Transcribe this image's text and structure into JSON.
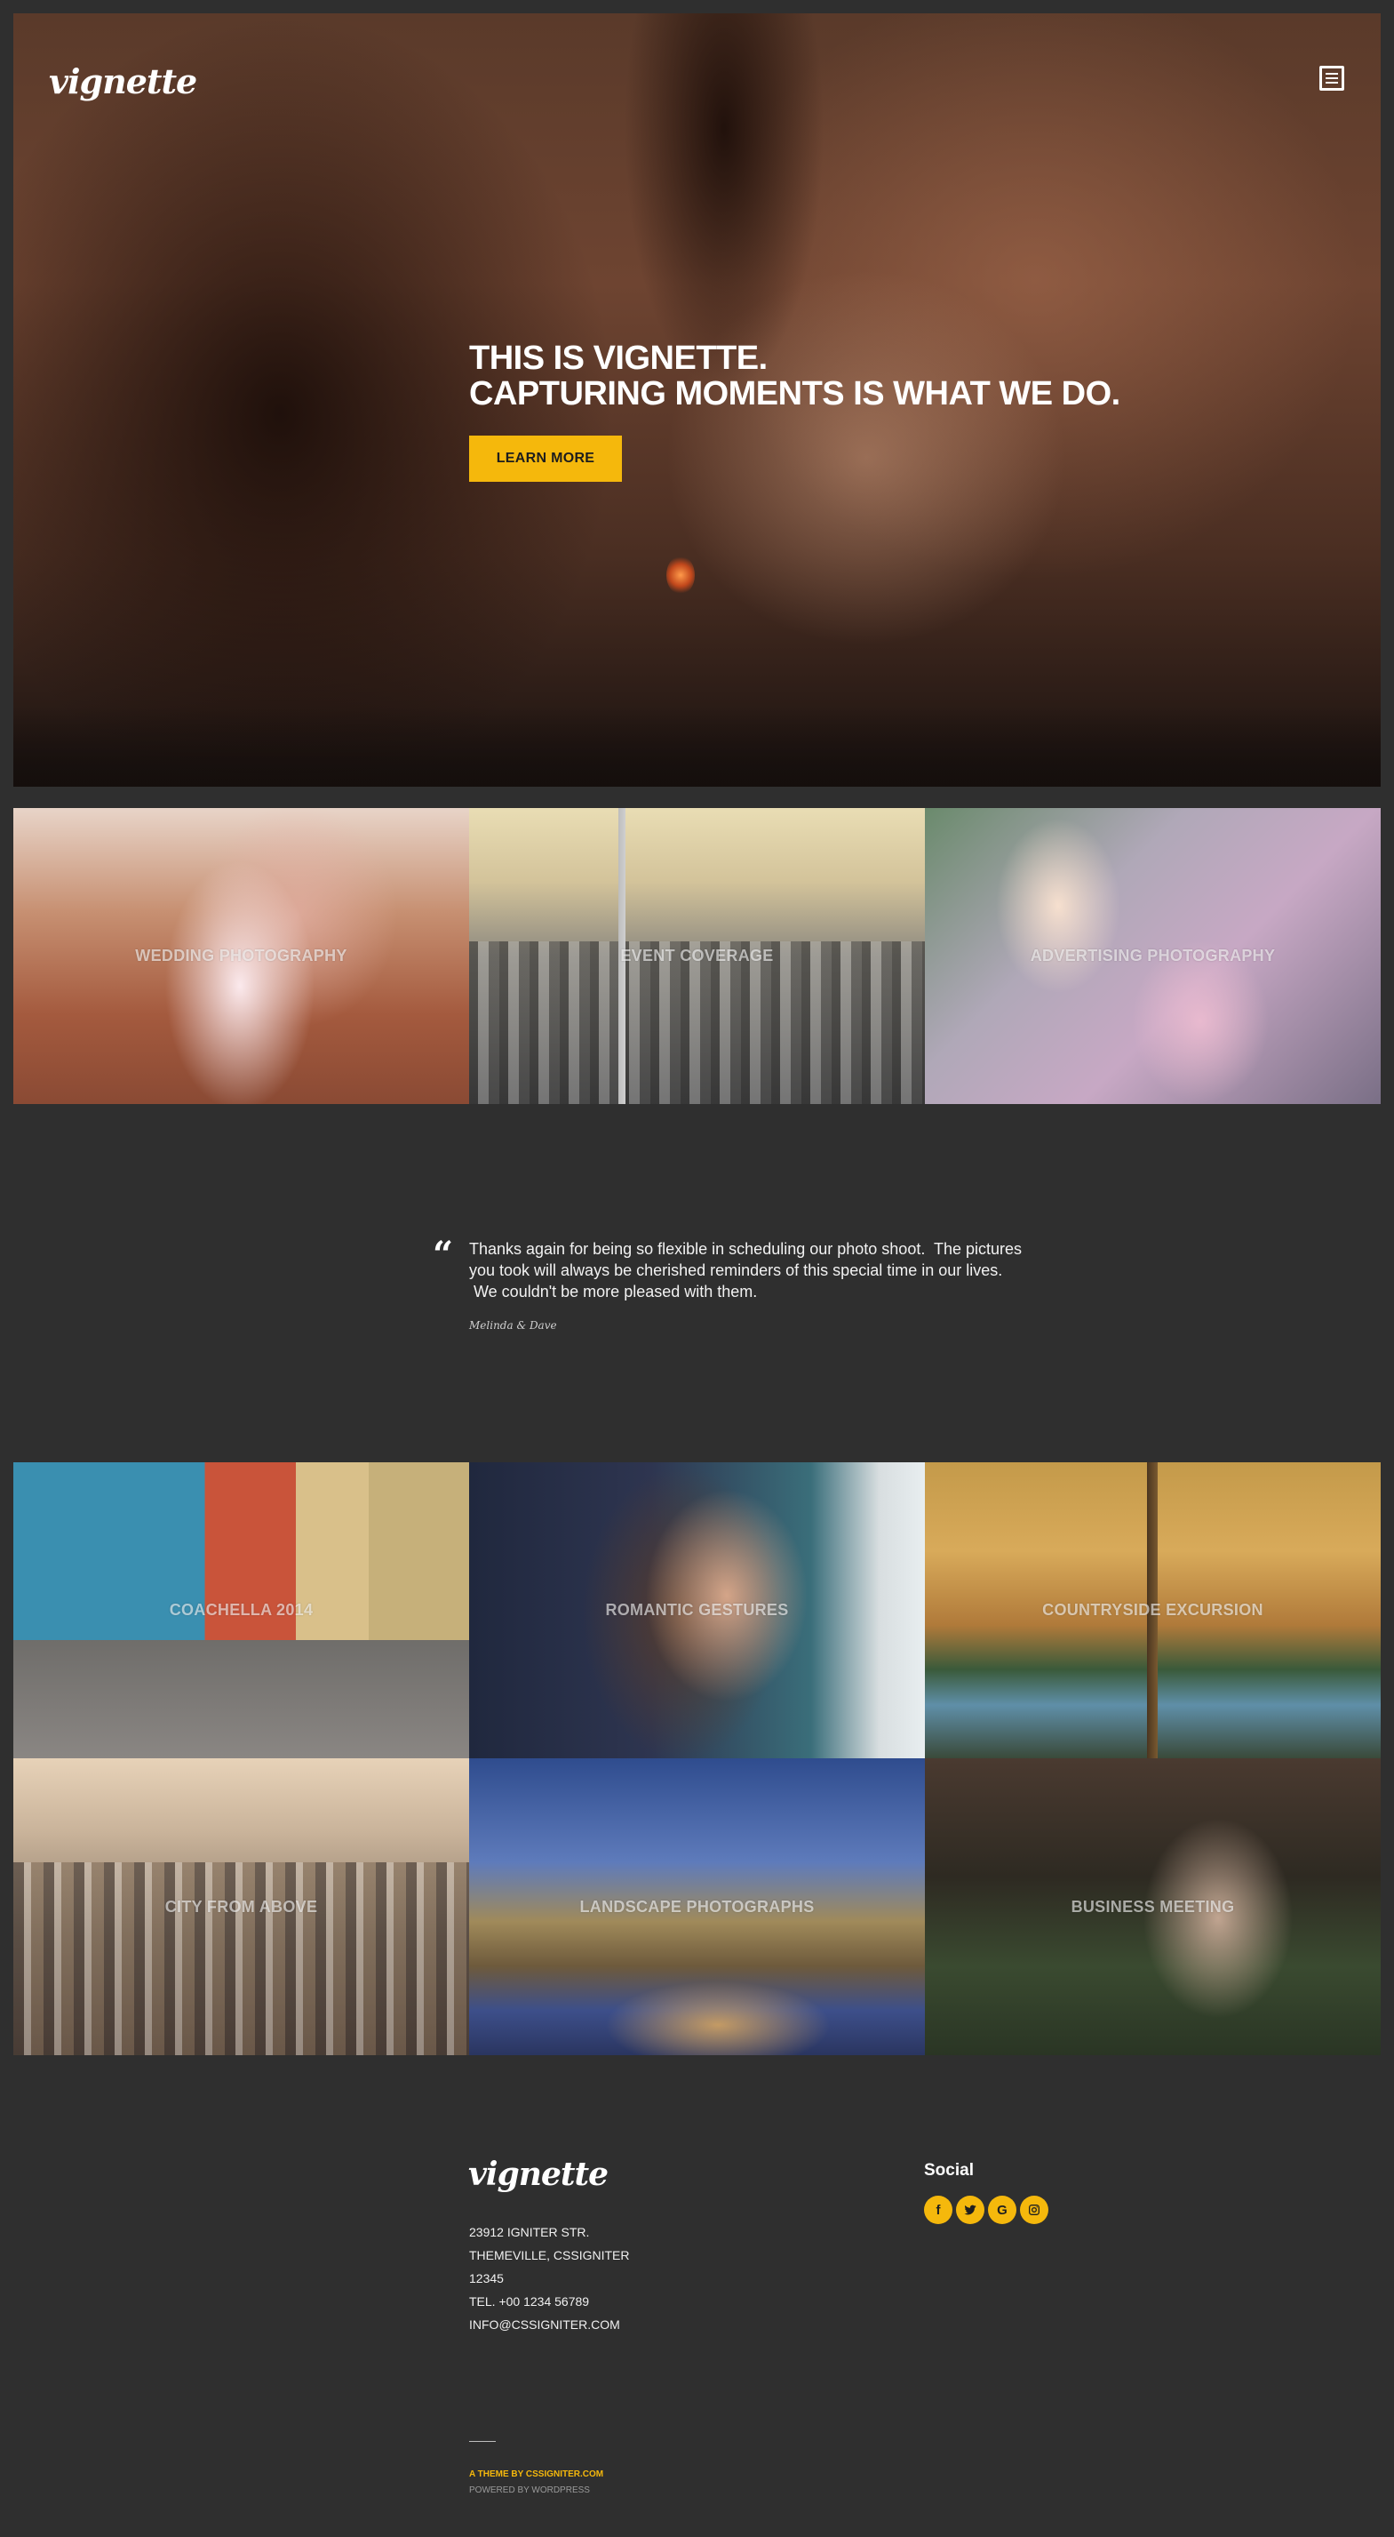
{
  "brand": {
    "logo_text": "vignette"
  },
  "header": {
    "menu_icon": "menu-icon"
  },
  "hero": {
    "title_line1": "THIS IS VIGNETTE.",
    "title_line2": "CAPTURING MOMENTS IS WHAT WE DO.",
    "cta_label": "LEARN MORE"
  },
  "services": [
    {
      "label": "WEDDING PHOTOGRAPHY"
    },
    {
      "label": "EVENT COVERAGE"
    },
    {
      "label": "ADVERTISING PHOTOGRAPHY"
    }
  ],
  "testimonial": {
    "lines": [
      "Thanks again for being so flexible in scheduling our photo shoot.  The pictures",
      "you took will always be cherished reminders of this special time in our lives.",
      " We couldn't be more pleased with them."
    ],
    "author": "Melinda & Dave"
  },
  "galleries": [
    {
      "label": "COACHELLA 2014"
    },
    {
      "label": "ROMANTIC GESTURES"
    },
    {
      "label": "COUNTRYSIDE EXCURSION"
    },
    {
      "label": "CITY FROM ABOVE"
    },
    {
      "label": "LANDSCAPE PHOTOGRAPHS"
    },
    {
      "label": "BUSINESS MEETING"
    }
  ],
  "footer": {
    "address_lines": [
      "23912 IGNITER STR.",
      "THEMEVILLE, CSSIGNITER",
      "12345",
      "TEL. +00 1234 56789",
      "INFO@CSSIGNITER.COM"
    ],
    "social_title": "Social",
    "social_links": [
      {
        "icon": "facebook-icon",
        "glyph": "f"
      },
      {
        "icon": "twitter-icon",
        "glyph": "t"
      },
      {
        "icon": "google-icon",
        "glyph": "G"
      },
      {
        "icon": "instagram-icon",
        "glyph": "ig"
      }
    ],
    "credit_theme": "A THEME BY CSSIGNITER.COM",
    "credit_powered": "POWERED BY WORDPRESS"
  },
  "colors": {
    "accent": "#f5b80c",
    "background": "#2f2f2f"
  }
}
